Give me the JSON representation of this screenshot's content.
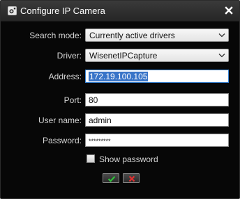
{
  "window": {
    "title": "Configure IP Camera",
    "icon": "camera-settings-icon",
    "close_icon": "close-icon"
  },
  "form": {
    "search_mode": {
      "label": "Search mode:",
      "value": "Currently active drivers"
    },
    "driver": {
      "label": "Driver:",
      "value": "WisenetIPCapture"
    },
    "address": {
      "label": "Address:",
      "value": "172.19.100.105",
      "selected": true
    },
    "port": {
      "label": "Port:",
      "value": "80"
    },
    "user_name": {
      "label": "User name:",
      "value": "admin"
    },
    "password": {
      "label": "Password:",
      "value": "*********"
    },
    "show_password": {
      "label": "Show password",
      "checked": false
    }
  },
  "buttons": {
    "ok_icon": "checkmark-icon",
    "cancel_icon": "x-icon"
  },
  "colors": {
    "background": "#070707",
    "titlebar": "#2e2e2e",
    "label_text": "#d4d4d4",
    "selection": "#3874c8",
    "ok_green": "#2fc23a",
    "cancel_red": "#e03030"
  }
}
